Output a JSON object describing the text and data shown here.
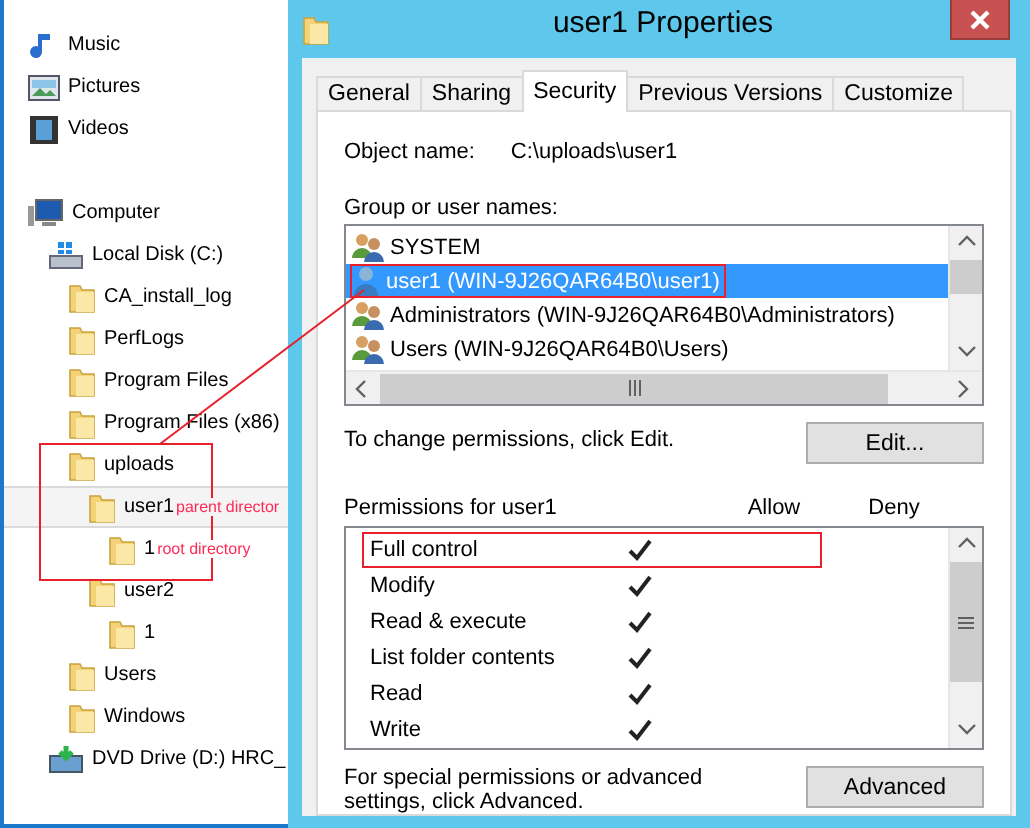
{
  "tree": [
    {
      "label": "Music",
      "kind": "music",
      "selected": false
    },
    {
      "label": "Pictures",
      "kind": "pictures",
      "selected": false
    },
    {
      "label": "Videos",
      "kind": "videos",
      "selected": false
    },
    {
      "kind": "gap"
    },
    {
      "label": "Computer",
      "kind": "computer",
      "selected": false,
      "children": [
        {
          "label": "Local Disk (C:)",
          "kind": "disk",
          "selected": false,
          "children": [
            {
              "label": "CA_install_log",
              "kind": "folder",
              "selected": false
            },
            {
              "label": "PerfLogs",
              "kind": "folder",
              "selected": false
            },
            {
              "label": "Program Files",
              "kind": "folder",
              "selected": false
            },
            {
              "label": "Program Files (x86)",
              "kind": "folder",
              "selected": false
            },
            {
              "label": "uploads",
              "kind": "folder",
              "selected": false,
              "children": [
                {
                  "label": "user1",
                  "kind": "folder",
                  "selected": true,
                  "note": "parent director",
                  "children": [
                    {
                      "label": "1",
                      "kind": "folder",
                      "selected": false,
                      "note": "root directory"
                    }
                  ]
                },
                {
                  "label": "user2",
                  "kind": "folder",
                  "selected": false,
                  "children": [
                    {
                      "label": "1",
                      "kind": "folder",
                      "selected": false
                    }
                  ]
                }
              ]
            },
            {
              "label": "Users",
              "kind": "folder",
              "selected": false
            },
            {
              "label": "Windows",
              "kind": "folder",
              "selected": false
            }
          ]
        },
        {
          "label": "DVD Drive (D:) HRC_",
          "kind": "dvd",
          "selected": false
        }
      ]
    }
  ],
  "dialog": {
    "title": "user1 Properties",
    "tabs": [
      {
        "label": "General",
        "selected": false
      },
      {
        "label": "Sharing",
        "selected": false
      },
      {
        "label": "Security",
        "selected": true
      },
      {
        "label": "Previous Versions",
        "selected": false
      },
      {
        "label": "Customize",
        "selected": false
      }
    ],
    "object_name_label": "Object name:",
    "object_name": "C:\\uploads\\user1",
    "group_label": "Group or user names:",
    "groups": [
      {
        "name": "SYSTEM",
        "kind": "group",
        "selected": false,
        "highlighted": false
      },
      {
        "name": "user1 (WIN-9J26QAR64B0\\user1)",
        "kind": "user",
        "selected": true,
        "highlighted": true
      },
      {
        "name": "Administrators (WIN-9J26QAR64B0\\Administrators)",
        "kind": "group",
        "selected": false,
        "highlighted": false
      },
      {
        "name": "Users (WIN-9J26QAR64B0\\Users)",
        "kind": "group",
        "selected": false,
        "highlighted": false
      }
    ],
    "edit_hint": "To change permissions, click Edit.",
    "edit_button": "Edit...",
    "permissions_label": "Permissions for user1",
    "allow_header": "Allow",
    "deny_header": "Deny",
    "permissions": [
      {
        "name": "Full control",
        "allow": true,
        "deny": false,
        "highlighted": true
      },
      {
        "name": "Modify",
        "allow": true,
        "deny": false,
        "highlighted": false
      },
      {
        "name": "Read & execute",
        "allow": true,
        "deny": false,
        "highlighted": false
      },
      {
        "name": "List folder contents",
        "allow": true,
        "deny": false,
        "highlighted": false
      },
      {
        "name": "Read",
        "allow": true,
        "deny": false,
        "highlighted": false
      },
      {
        "name": "Write",
        "allow": true,
        "deny": false,
        "highlighted": false
      }
    ],
    "advanced_hint": "For special permissions or advanced settings, click Advanced.",
    "advanced_button": "Advanced"
  }
}
